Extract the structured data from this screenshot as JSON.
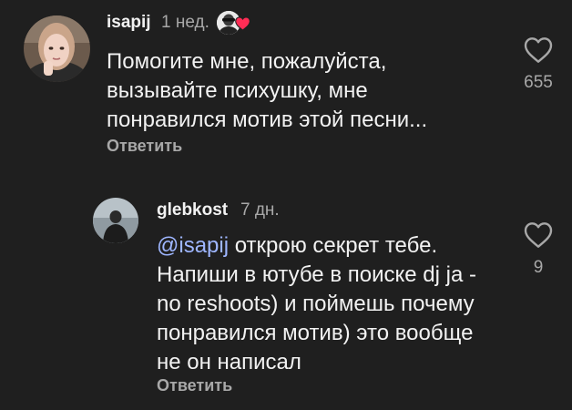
{
  "colors": {
    "background": "#1f1f1f",
    "primary_text": "#f2f2f2",
    "secondary_text": "#a8a8a8",
    "mention": "#9eb6ff",
    "heart_red": "#ff2d55"
  },
  "comments": [
    {
      "username": "isapij",
      "time": "1 нед.",
      "liked_by_author": true,
      "text_lines": [
        "Помогите мне, пожалуйста,",
        "вызывайте психушку, мне",
        "понравился мотив этой песни..."
      ],
      "reply_label": "Ответить",
      "like_icon": "heart-outline-icon",
      "like_count": "655"
    }
  ],
  "replies": [
    {
      "username": "glebkost",
      "time": "7 дн.",
      "mention": "@isapij",
      "text_first_line_rest": " открою секрет тебе.",
      "text_lines": [
        "Напиши в ютубе в поиске dj ja -",
        "no reshoots) и поймешь почему",
        "понравился мотив) это вообще",
        "не он написал"
      ],
      "reply_label": "Ответить",
      "like_icon": "heart-outline-icon",
      "like_count": "9"
    }
  ]
}
